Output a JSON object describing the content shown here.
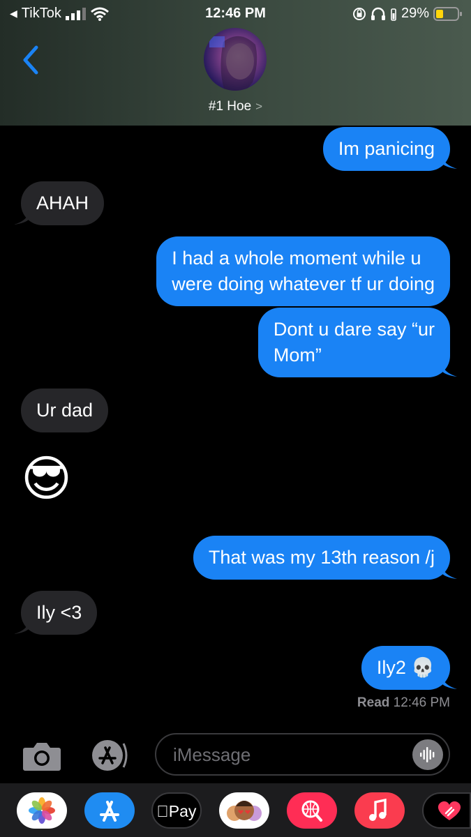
{
  "status_bar": {
    "back_app": "TikTok",
    "time": "12:46 PM",
    "battery": "29%"
  },
  "header": {
    "contact_name": "#1 Hoe",
    "icons": [
      "back-chevron-icon",
      "avatar",
      "chevron-right-icon"
    ]
  },
  "messages": [
    {
      "side": "out",
      "text": "Im panicing"
    },
    {
      "side": "in",
      "text": "AHAH"
    },
    {
      "side": "out",
      "text": "I had a whole moment while u\nwere doing whatever tf ur doing"
    },
    {
      "side": "out",
      "text": "Dont u dare say “ur\nMom”"
    },
    {
      "side": "in",
      "text": "Ur dad"
    },
    {
      "side": "in",
      "text": "😎",
      "emoji_only": true
    },
    {
      "side": "out",
      "text": "That was my 13th reason /j"
    },
    {
      "side": "in",
      "text": "Ily <3"
    },
    {
      "side": "out",
      "text": "Ily2 💀"
    }
  ],
  "read_receipt": {
    "label": "Read",
    "time": "12:46 PM"
  },
  "input": {
    "placeholder": "iMessage"
  },
  "app_drawer": {
    "apple_pay_label": "Pay",
    "apps": [
      "photos-icon",
      "app-store-icon",
      "apple-pay-icon",
      "memoji-icon",
      "web-search-icon",
      "music-icon",
      "digital-touch-icon"
    ]
  },
  "colors": {
    "outgoing_bubble": "#1a83f5",
    "incoming_bubble": "#262629",
    "accent_blue": "#1a83f5",
    "battery_low": "#ffd60a"
  }
}
